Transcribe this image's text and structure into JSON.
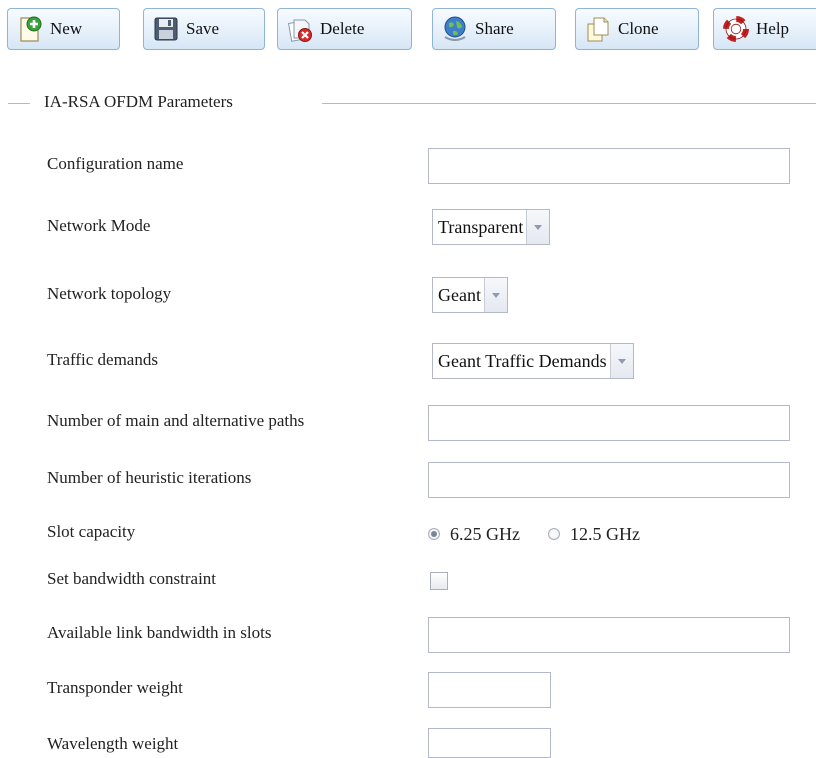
{
  "toolbar": {
    "new_label": "New",
    "save_label": "Save",
    "delete_label": "Delete",
    "share_label": "Share",
    "clone_label": "Clone",
    "help_label": "Help"
  },
  "fieldset": {
    "legend": "IA-RSA OFDM Parameters"
  },
  "form": {
    "config_name": {
      "label": "Configuration name",
      "value": ""
    },
    "network_mode": {
      "label": "Network Mode",
      "value": "Transparent"
    },
    "network_topology": {
      "label": "Network topology",
      "value": "Geant"
    },
    "traffic_demands": {
      "label": "Traffic demands",
      "value": "Geant Traffic Demands"
    },
    "num_paths": {
      "label": "Number of main and alternative paths",
      "value": ""
    },
    "num_iterations": {
      "label": "Number of heuristic iterations",
      "value": ""
    },
    "slot_capacity": {
      "label": "Slot capacity",
      "options": [
        "6.25 GHz",
        "12.5 GHz"
      ],
      "selected": "6.25 GHz"
    },
    "bandwidth_constraint": {
      "label": "Set bandwidth constraint",
      "checked": false
    },
    "available_bandwidth": {
      "label": "Available link bandwidth in slots",
      "value": ""
    },
    "transponder_weight": {
      "label": "Transponder weight",
      "value": ""
    },
    "wavelength_weight": {
      "label": "Wavelength weight",
      "value": ""
    }
  },
  "colors": {
    "button_border": "#8fb4d8",
    "button_bg_top": "#f7fbff",
    "button_bg_bottom": "#d6e6f6",
    "input_border": "#b5b8c8",
    "fieldset_line": "#b9b9b9"
  },
  "icons": {
    "new": "new-document-icon",
    "save": "floppy-disk-icon",
    "delete": "delete-document-icon",
    "share": "globe-share-icon",
    "clone": "clone-document-icon",
    "help": "lifebuoy-help-icon",
    "combo_trigger": "chevron-down-icon"
  }
}
